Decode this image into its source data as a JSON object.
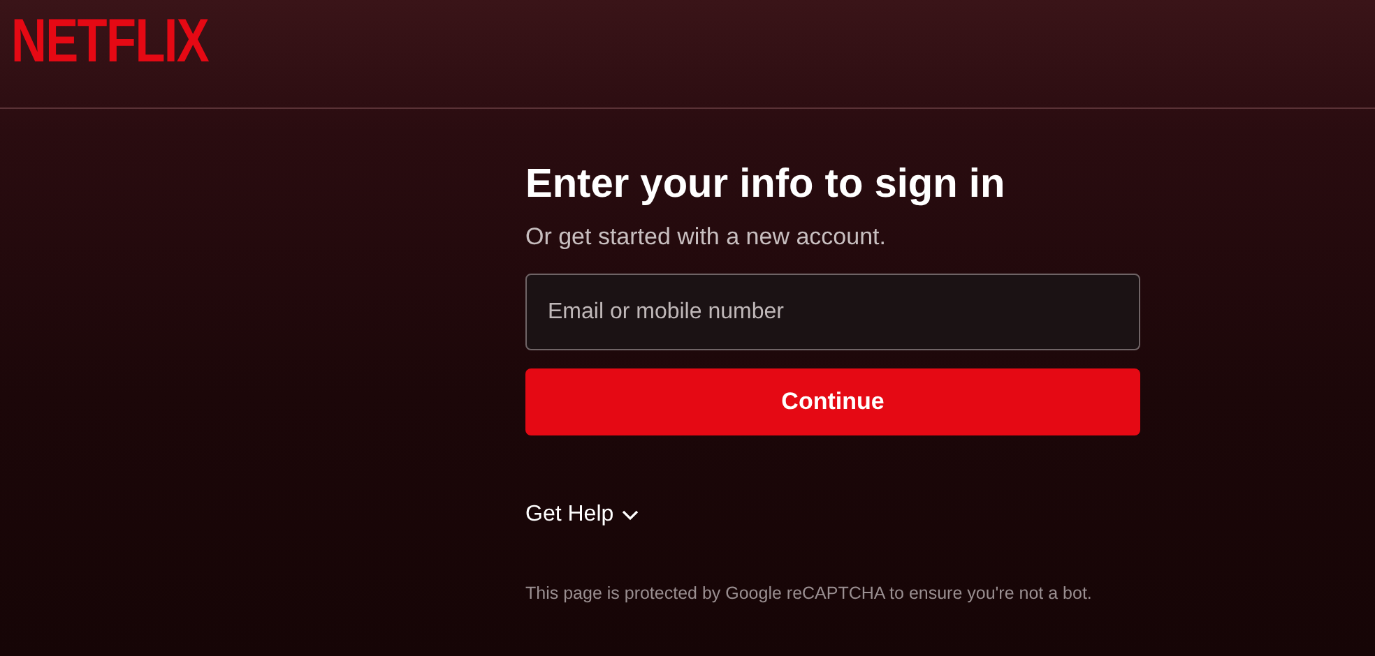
{
  "header": {
    "logo": "NETFLIX"
  },
  "form": {
    "title": "Enter your info to sign in",
    "subtitle": "Or get started with a new account.",
    "email": {
      "placeholder": "Email or mobile number"
    },
    "submit": "Continue"
  },
  "help": {
    "label": "Get Help"
  },
  "footer": {
    "text": "This page is protected by Google reCAPTCHA to ensure you're not a bot."
  }
}
